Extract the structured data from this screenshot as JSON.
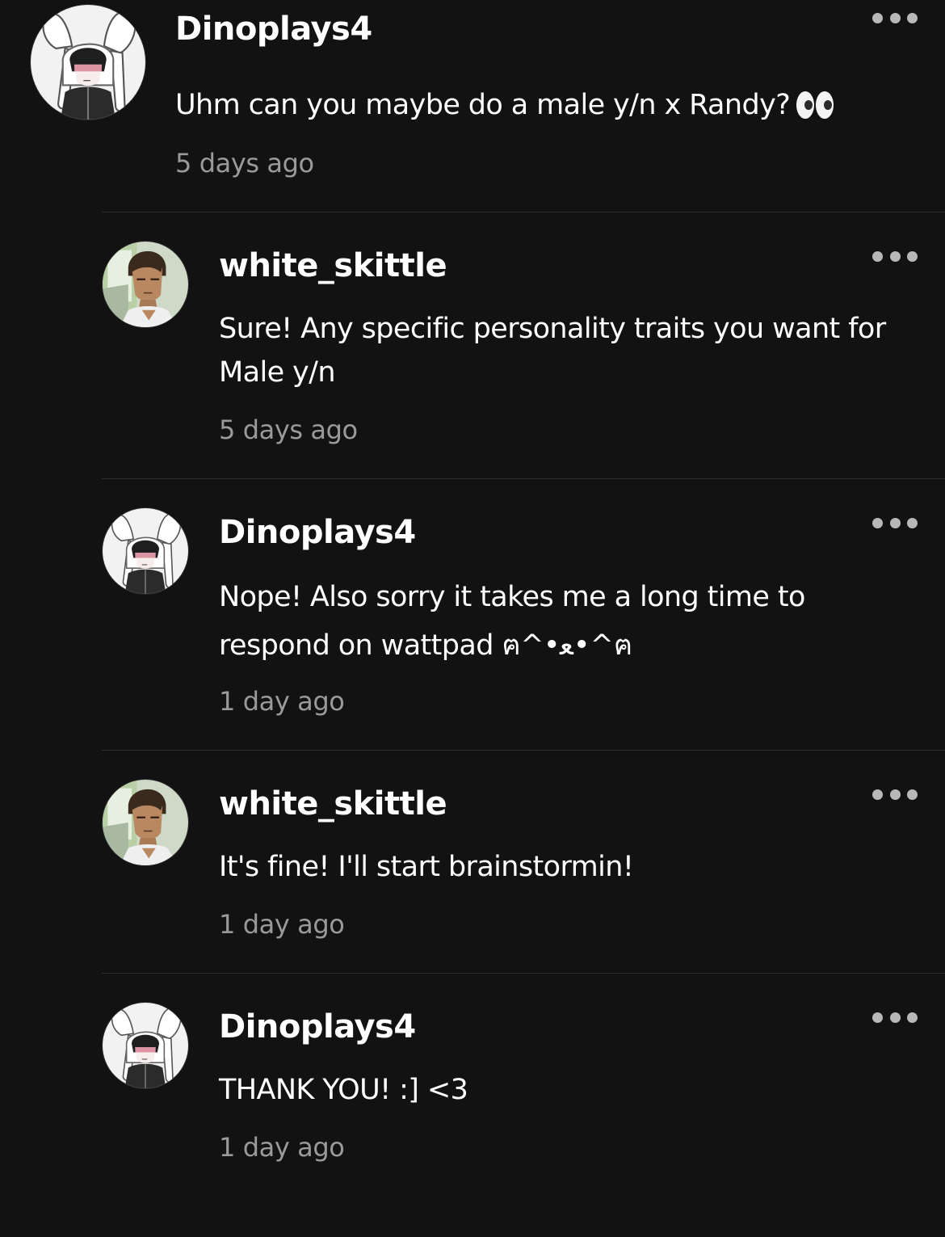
{
  "comments": [
    {
      "username": "Dinoplays4",
      "text": "Uhm can you maybe do a male y/n x Randy?",
      "emoji": "eyes-emoji",
      "timestamp": "5 days ago",
      "avatar": "bunny-hood-avatar"
    },
    {
      "username": "white_skittle",
      "text": "Sure! Any specific personality traits you want for Male y/n",
      "timestamp": "5 days ago",
      "avatar": "anime-boy-avatar"
    },
    {
      "username": "Dinoplays4",
      "text": "Nope! Also sorry it takes me a long time to respond on wattpad ฅ^•ﻌ•^ฅ",
      "timestamp": "1 day ago",
      "avatar": "bunny-hood-avatar"
    },
    {
      "username": "white_skittle",
      "text": "It's fine! I'll start brainstormin!",
      "timestamp": "1 day ago",
      "avatar": "anime-boy-avatar"
    },
    {
      "username": "Dinoplays4",
      "text": "THANK YOU! :] <3",
      "timestamp": "1 day ago",
      "avatar": "bunny-hood-avatar"
    }
  ],
  "colors": {
    "background": "#121212",
    "text": "#ffffff",
    "timestamp": "#9a9a9a",
    "divider": "#2e2e2e",
    "more_dots": "#b8b8b8"
  },
  "icons": {
    "more": "more-options-icon"
  }
}
